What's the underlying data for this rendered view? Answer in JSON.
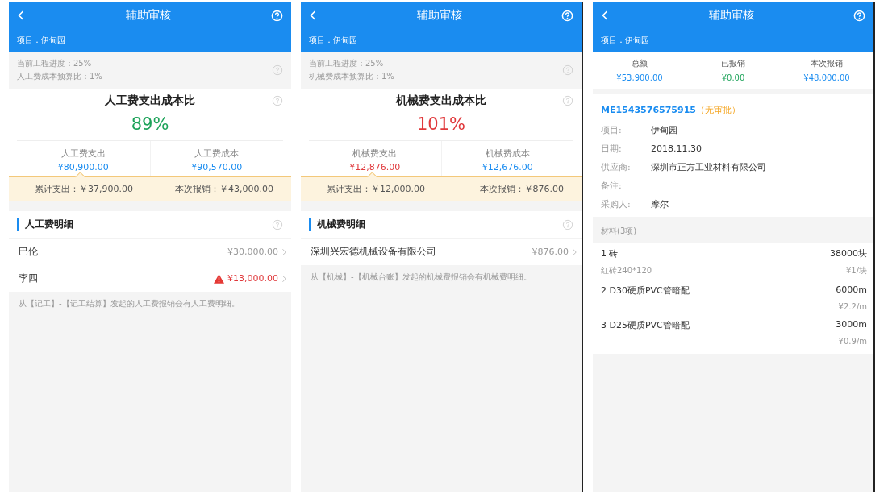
{
  "panels": [
    {
      "kind": "ratio",
      "title": "辅助审核",
      "project": "项目：伊甸园",
      "info": [
        "当前工程进度：25%",
        "人工费成本预算比：1%"
      ],
      "ratio_title": "人工费支出成本比",
      "ratio": "89%",
      "over_budget": false,
      "stats": [
        {
          "label": "人工费支出",
          "value": "¥80,900.00",
          "alert": false
        },
        {
          "label": "人工费成本",
          "value": "¥90,570.00",
          "alert": false
        }
      ],
      "summary": [
        "累计支出：￥37,900.00",
        "本次报销：￥43,000.00"
      ],
      "section": "人工费明细",
      "rows": [
        {
          "name": "巴伦",
          "amount": "¥30,000.00",
          "warning": false
        },
        {
          "name": "李四",
          "amount": "¥13,000.00",
          "warning": true
        }
      ],
      "note": "从【记工】-【记工结算】发起的人工费报销会有人工费明细。"
    },
    {
      "kind": "ratio",
      "title": "辅助审核",
      "project": "项目：伊甸园",
      "info": [
        "当前工程进度：25%",
        "机械费成本预算比：1%"
      ],
      "ratio_title": "机械费支出成本比",
      "ratio": "101%",
      "over_budget": true,
      "stats": [
        {
          "label": "机械费支出",
          "value": "¥12,876.00",
          "alert": true
        },
        {
          "label": "机械费成本",
          "value": "¥12,676.00",
          "alert": false
        }
      ],
      "summary": [
        "累计支出：￥12,000.00",
        "本次报销：￥876.00"
      ],
      "section": "机械费明细",
      "rows": [
        {
          "name": "深圳兴宏德机械设备有限公司",
          "amount": "¥876.00",
          "warning": false
        }
      ],
      "note": "从【机械】-【机械台账】发起的机械费报销会有机械费明细。"
    },
    {
      "kind": "purchase",
      "title": "辅助审核",
      "project": "项目：伊甸园",
      "totals": [
        {
          "label": "总额",
          "value": "¥53,900.00"
        },
        {
          "label": "已报销",
          "value": "¥0.00"
        },
        {
          "label": "本次报销",
          "value": "¥48,000.00"
        }
      ],
      "order_no": "ME1543576575915",
      "order_status": "（无审批）",
      "fields": [
        {
          "label": "项目:",
          "value": "伊甸园"
        },
        {
          "label": "日期:",
          "value": "2018.11.30"
        },
        {
          "label": "供应商:",
          "value": "深圳市正方工业材料有限公司"
        },
        {
          "label": "备注:"
        },
        {
          "label": "采购人:",
          "value": "摩尔"
        }
      ],
      "materials_title": "材料(3项)",
      "materials": [
        {
          "name": "1 砖",
          "qty": "38000块",
          "spec": "红砖240*120",
          "price": "¥1/块"
        },
        {
          "name": "2 D30硬质PVC管暗配",
          "qty": "6000m",
          "price": "¥2.2/m"
        },
        {
          "name": "3 D25硬质PVC管暗配",
          "qty": "3000m",
          "price": "¥0.9/m"
        }
      ]
    }
  ]
}
